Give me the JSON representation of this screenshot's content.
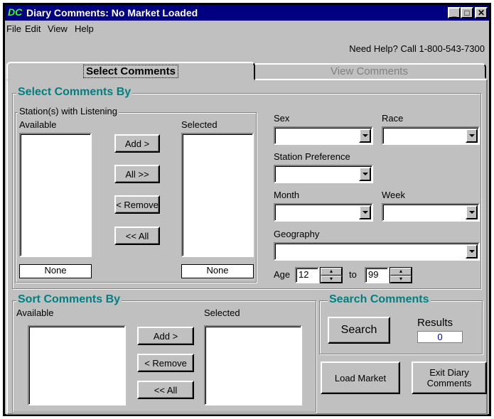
{
  "window": {
    "title": "Diary Comments: No Market Loaded",
    "icon_text": "DC",
    "minimize": "_",
    "maximize": "□",
    "close": "✕"
  },
  "menu": [
    "File",
    "Edit",
    "View",
    "Help"
  ],
  "help_text": "Need Help?  Call 1-800-543-7300",
  "tabs": [
    "Select Comments",
    "View Comments"
  ],
  "select_by": {
    "title": "Select Comments By",
    "stations": {
      "title": "Station(s) with Listening",
      "available_label": "Available",
      "selected_label": "Selected",
      "buttons": [
        "Add >",
        "All >>",
        "< Remove",
        "<< All"
      ],
      "available_count": "None",
      "selected_count": "None"
    },
    "filters": {
      "sex": "Sex",
      "race": "Race",
      "station_pref": "Station Preference",
      "month": "Month",
      "week": "Week",
      "geography": "Geography",
      "age_label": "Age",
      "age_from": "12",
      "age_to_label": "to",
      "age_to": "99"
    }
  },
  "sort_by": {
    "title": "Sort Comments By",
    "available_label": "Available",
    "selected_label": "Selected",
    "buttons": [
      "Add >",
      "< Remove",
      "<< All"
    ]
  },
  "search": {
    "title": "Search Comments",
    "button": "Search",
    "results_label": "Results",
    "results_value": "0"
  },
  "actions": {
    "load": "Load Market",
    "exit": "Exit Diary Comments"
  }
}
